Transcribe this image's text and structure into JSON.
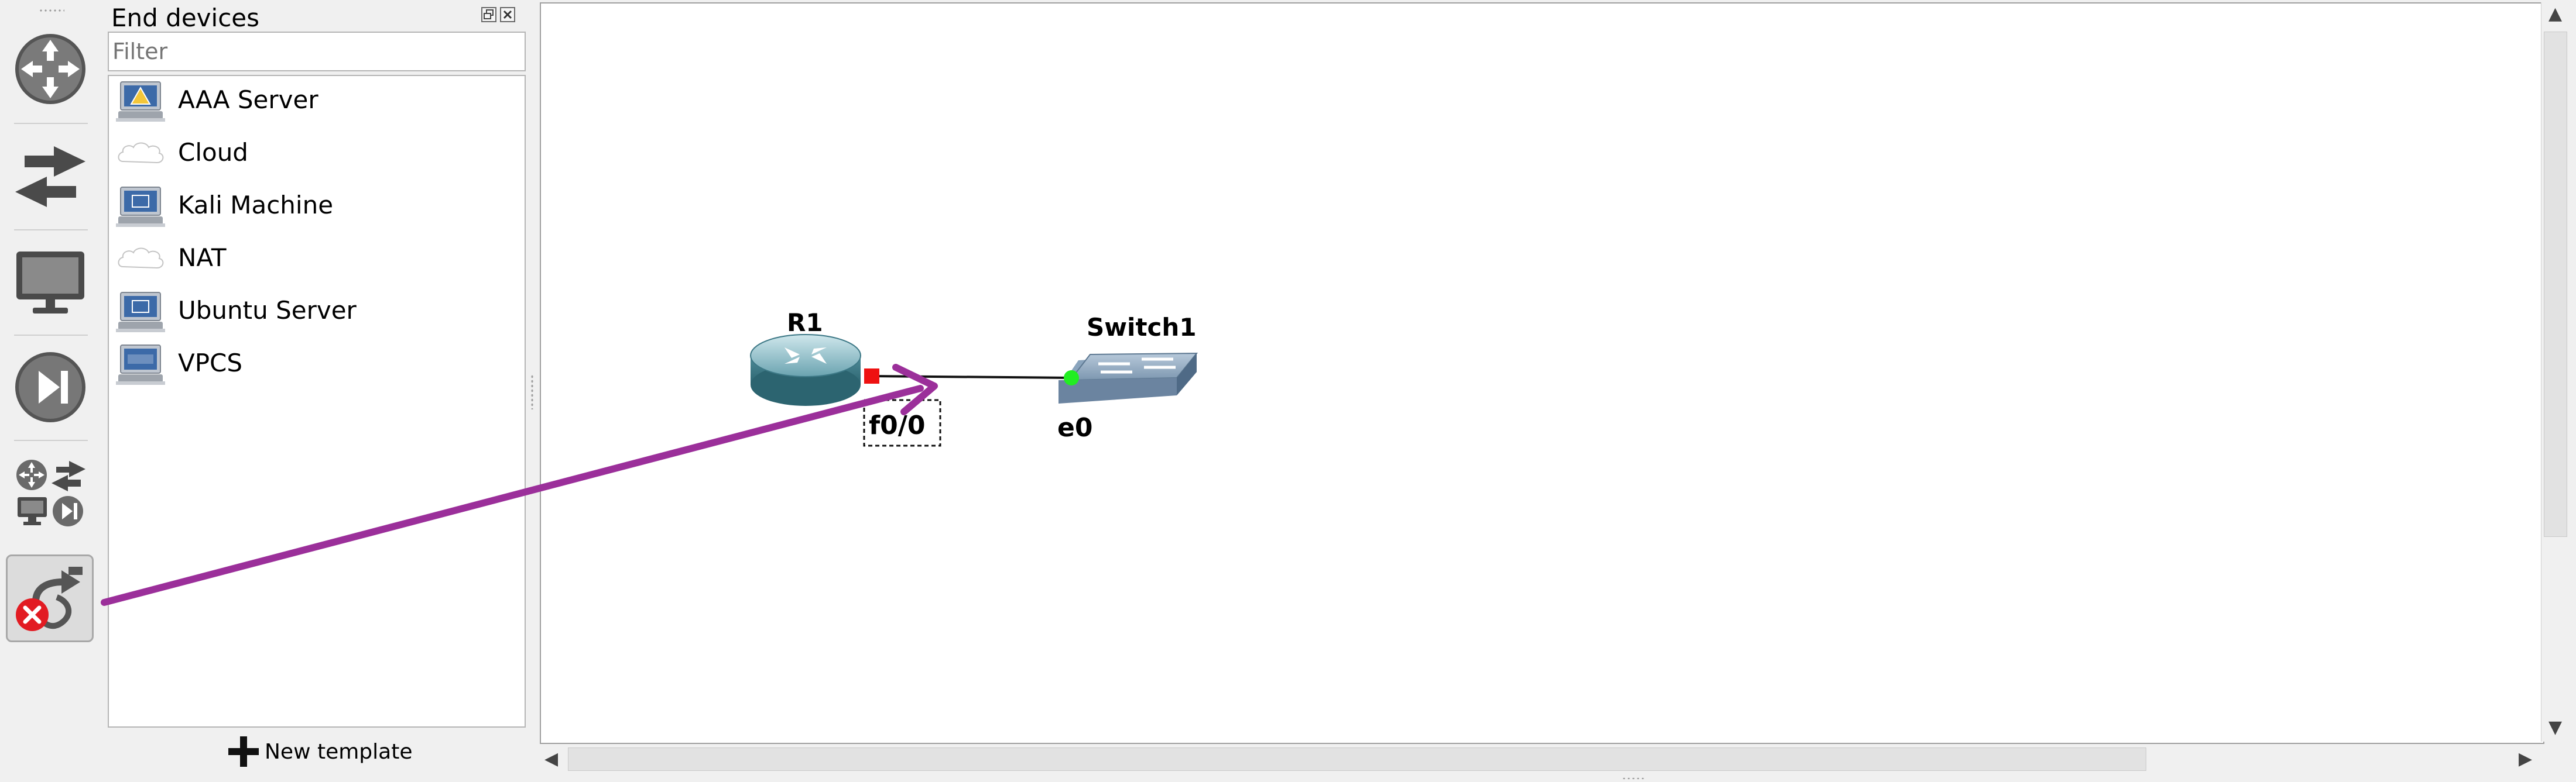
{
  "dock": {
    "title": "End devices",
    "filter_placeholder": "Filter",
    "new_template_label": "New template",
    "devices": [
      {
        "label": "AAA Server",
        "icon": "server-icon"
      },
      {
        "label": "Cloud",
        "icon": "cloud-icon"
      },
      {
        "label": "Kali Machine",
        "icon": "vm-computer-icon"
      },
      {
        "label": "NAT",
        "icon": "cloud-icon"
      },
      {
        "label": "Ubuntu Server",
        "icon": "vm-computer-icon"
      },
      {
        "label": "VPCS",
        "icon": "vpcs-computer-icon"
      }
    ]
  },
  "toolbar": {
    "buttons": [
      {
        "name": "browse-routers",
        "icon": "router-icon"
      },
      {
        "name": "browse-switches",
        "icon": "switch-arrows-icon"
      },
      {
        "name": "browse-end-devices",
        "icon": "monitor-icon"
      },
      {
        "name": "browse-security-devices",
        "icon": "play-next-icon"
      },
      {
        "name": "browse-all-devices",
        "icon": "all-devices-icon"
      },
      {
        "name": "add-link",
        "icon": "cancel-link-icon"
      }
    ]
  },
  "topology": {
    "nodes": [
      {
        "name": "R1",
        "type": "router"
      },
      {
        "name": "Switch1",
        "type": "switch"
      }
    ],
    "link": {
      "source_port": "f0/0",
      "target_port": "e0",
      "source_status_color": "#ee1111",
      "target_status_color": "#22ee22"
    },
    "annotation_color": "#9b2f9a"
  }
}
